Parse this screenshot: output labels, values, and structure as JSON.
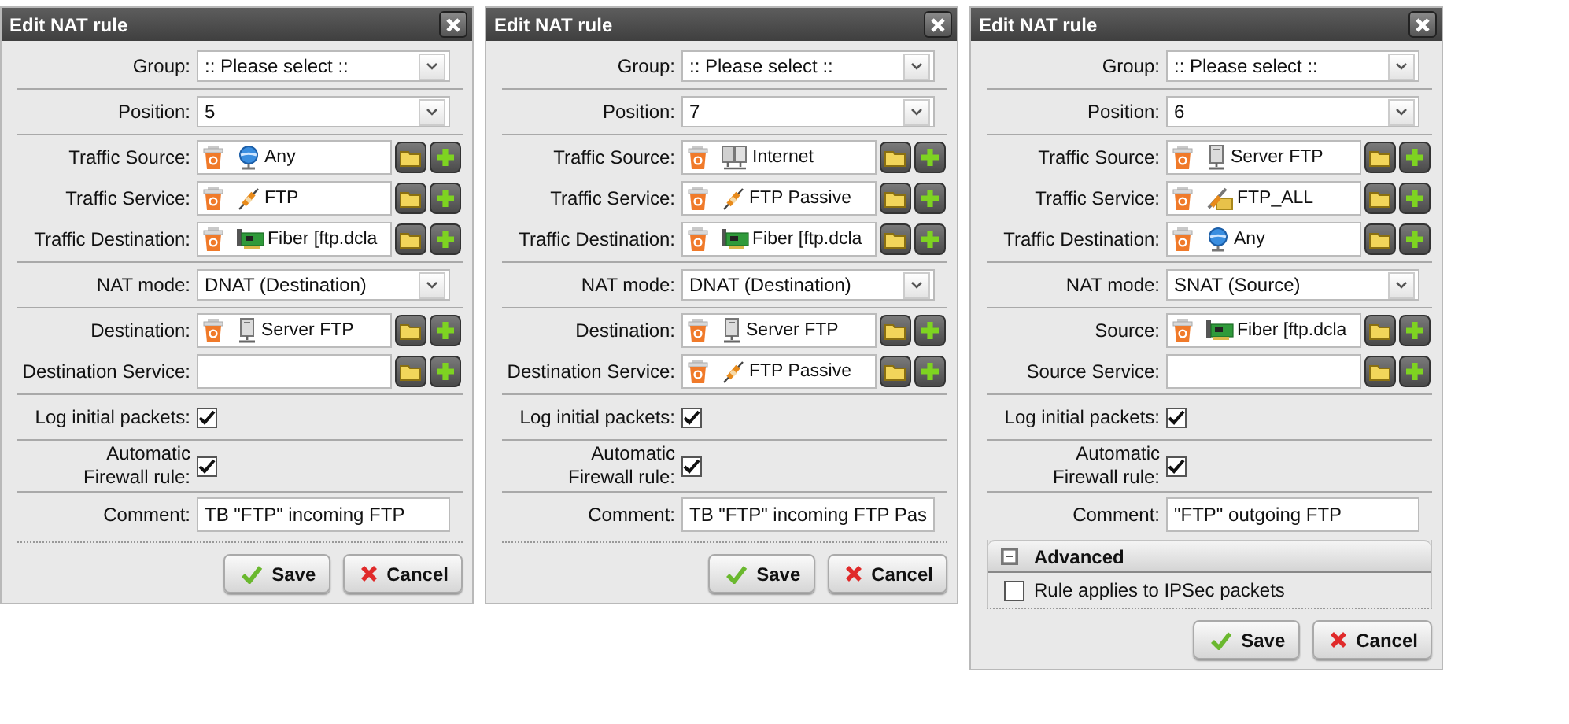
{
  "dialogs": [
    {
      "title": "Edit NAT rule",
      "sections": [
        {
          "kind": "rows",
          "rows": [
            {
              "kind": "select",
              "label": "Group:",
              "value": ":: Please select ::"
            }
          ]
        },
        {
          "kind": "rows",
          "rows": [
            {
              "kind": "select",
              "label": "Position:",
              "value": "5"
            }
          ]
        },
        {
          "kind": "rows",
          "rows": [
            {
              "kind": "object",
              "label": "Traffic Source:",
              "object": {
                "kind": "network",
                "name": "Any"
              }
            },
            {
              "kind": "object",
              "label": "Traffic Service:",
              "object": {
                "kind": "service",
                "name": "FTP"
              }
            },
            {
              "kind": "object",
              "label": "Traffic Destination:",
              "object": {
                "kind": "interface",
                "name": "Fiber [ftp.dcla"
              }
            }
          ]
        },
        {
          "kind": "rows",
          "rows": [
            {
              "kind": "select",
              "label": "NAT mode:",
              "value": "DNAT (Destination)"
            }
          ]
        },
        {
          "kind": "rows",
          "rows": [
            {
              "kind": "object",
              "label": "Destination:",
              "object": {
                "kind": "host",
                "name": "Server FTP"
              }
            },
            {
              "kind": "object",
              "label": "Destination Service:"
            }
          ]
        },
        {
          "kind": "rows",
          "rows": [
            {
              "kind": "checkbox",
              "label": "Log initial packets:",
              "checked": true
            }
          ]
        },
        {
          "kind": "rows",
          "rows": [
            {
              "kind": "checkbox",
              "label": "Automatic Firewall rule:",
              "checked": true
            }
          ]
        },
        {
          "kind": "last",
          "rows": [
            {
              "kind": "text",
              "label": "Comment:",
              "value": "TB \"FTP\" incoming FTP"
            }
          ]
        }
      ],
      "buttons": [
        {
          "kind": "save",
          "label": "Save"
        },
        {
          "kind": "cancel",
          "label": "Cancel"
        }
      ]
    },
    {
      "title": "Edit NAT rule",
      "sections": [
        {
          "kind": "rows",
          "rows": [
            {
              "kind": "select",
              "label": "Group:",
              "value": ":: Please select ::"
            }
          ]
        },
        {
          "kind": "rows",
          "rows": [
            {
              "kind": "select",
              "label": "Position:",
              "value": "7"
            }
          ]
        },
        {
          "kind": "rows",
          "rows": [
            {
              "kind": "object",
              "label": "Traffic Source:",
              "object": {
                "kind": "hosts",
                "name": "Internet"
              }
            },
            {
              "kind": "object",
              "label": "Traffic Service:",
              "object": {
                "kind": "service",
                "name": "FTP Passive"
              }
            },
            {
              "kind": "object",
              "label": "Traffic Destination:",
              "object": {
                "kind": "interface",
                "name": "Fiber [ftp.dcla"
              }
            }
          ]
        },
        {
          "kind": "rows",
          "rows": [
            {
              "kind": "select",
              "label": "NAT mode:",
              "value": "DNAT (Destination)"
            }
          ]
        },
        {
          "kind": "rows",
          "rows": [
            {
              "kind": "object",
              "label": "Destination:",
              "object": {
                "kind": "host",
                "name": "Server FTP"
              }
            },
            {
              "kind": "object",
              "label": "Destination Service:",
              "object": {
                "kind": "service",
                "name": "FTP Passive"
              }
            }
          ]
        },
        {
          "kind": "rows",
          "rows": [
            {
              "kind": "checkbox",
              "label": "Log initial packets:",
              "checked": true
            }
          ]
        },
        {
          "kind": "rows",
          "rows": [
            {
              "kind": "checkbox",
              "label": "Automatic Firewall rule:",
              "checked": true
            }
          ]
        },
        {
          "kind": "last",
          "rows": [
            {
              "kind": "text",
              "label": "Comment:",
              "value": "TB \"FTP\" incoming FTP Pas"
            }
          ]
        }
      ],
      "buttons": [
        {
          "kind": "save",
          "label": "Save"
        },
        {
          "kind": "cancel",
          "label": "Cancel"
        }
      ]
    },
    {
      "title": "Edit NAT rule",
      "sections": [
        {
          "kind": "rows",
          "rows": [
            {
              "kind": "select",
              "label": "Group:",
              "value": ":: Please select ::"
            }
          ]
        },
        {
          "kind": "rows",
          "rows": [
            {
              "kind": "select",
              "label": "Position:",
              "value": "6"
            }
          ]
        },
        {
          "kind": "rows",
          "rows": [
            {
              "kind": "object",
              "label": "Traffic Source:",
              "object": {
                "kind": "host",
                "name": "Server FTP"
              }
            },
            {
              "kind": "object",
              "label": "Traffic Service:",
              "object": {
                "kind": "service_group",
                "name": "FTP_ALL"
              }
            },
            {
              "kind": "object",
              "label": "Traffic Destination:",
              "object": {
                "kind": "network",
                "name": "Any"
              }
            }
          ]
        },
        {
          "kind": "rows",
          "rows": [
            {
              "kind": "select",
              "label": "NAT mode:",
              "value": "SNAT (Source)"
            }
          ]
        },
        {
          "kind": "rows",
          "rows": [
            {
              "kind": "object",
              "label": "Source:",
              "object": {
                "kind": "interface",
                "name": "Fiber [ftp.dcla"
              }
            },
            {
              "kind": "object",
              "label": "Source Service:"
            }
          ]
        },
        {
          "kind": "rows",
          "rows": [
            {
              "kind": "checkbox",
              "label": "Log initial packets:",
              "checked": true
            }
          ]
        },
        {
          "kind": "rows",
          "rows": [
            {
              "kind": "checkbox",
              "label": "Automatic Firewall rule:",
              "checked": true
            }
          ]
        },
        {
          "kind": "plain",
          "rows": [
            {
              "kind": "text",
              "label": "Comment:",
              "value": "\"FTP\" outgoing FTP"
            }
          ]
        },
        {
          "kind": "panel",
          "title": "Advanced",
          "expanded": true,
          "options": [
            {
              "label": "Rule applies to IPSec packets",
              "checked": false
            }
          ]
        }
      ],
      "buttons": [
        {
          "kind": "save",
          "label": "Save"
        },
        {
          "kind": "cancel",
          "label": "Cancel"
        }
      ]
    }
  ]
}
